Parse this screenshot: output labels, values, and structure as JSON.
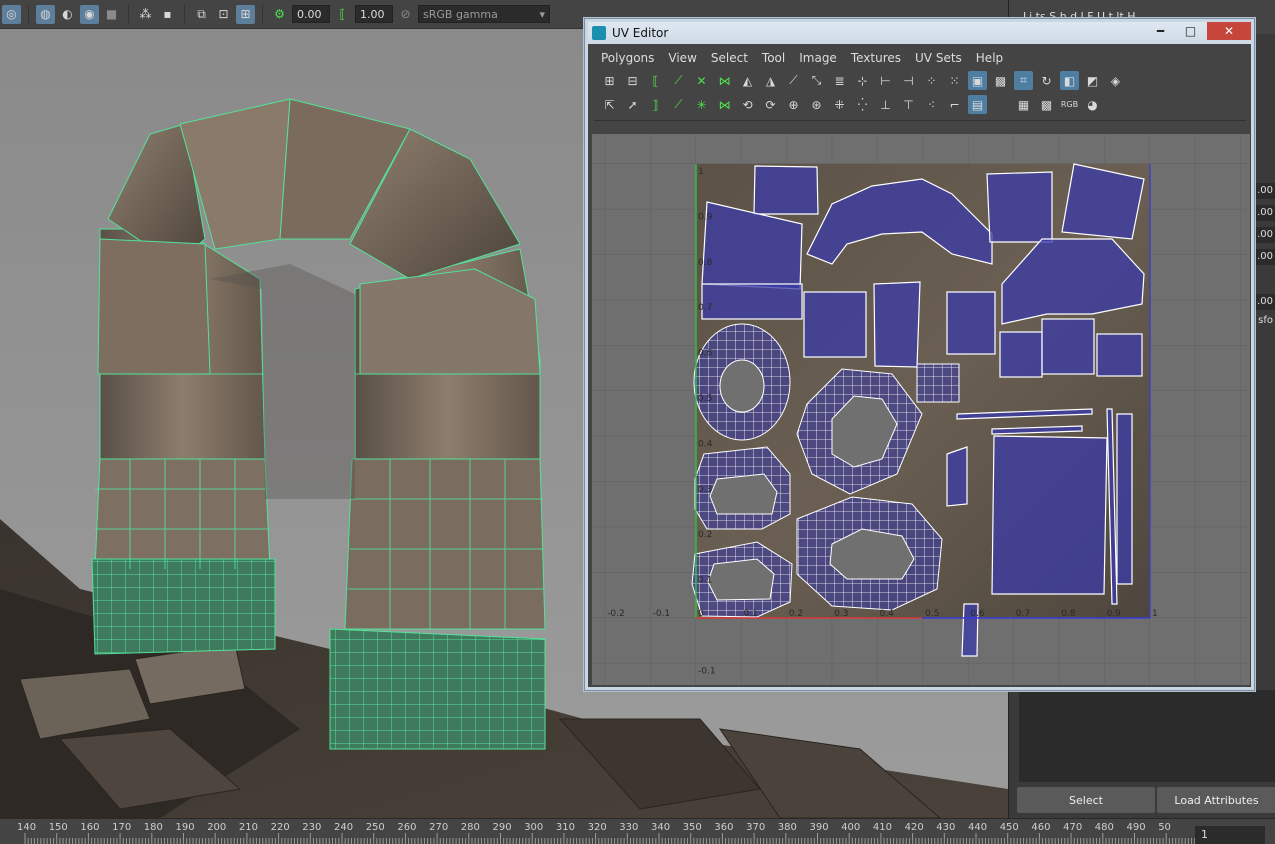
{
  "viewport_toolbar": {
    "exposure_value": "0.00",
    "gamma_value": "1.00",
    "color_space": "sRGB gamma"
  },
  "timeline": {
    "ticks": [
      "140",
      "150",
      "160",
      "170",
      "180",
      "190",
      "200",
      "210",
      "220",
      "230",
      "240",
      "250",
      "260",
      "270",
      "280",
      "290",
      "300",
      "310",
      "320",
      "330",
      "340",
      "350",
      "360",
      "370",
      "380",
      "390",
      "400",
      "410",
      "420",
      "430",
      "440",
      "450",
      "460",
      "470",
      "480",
      "490",
      "50"
    ],
    "current_frame": "1"
  },
  "attribute_panel": {
    "menu_text": "Li  ts  S  h  d  l  F  U  t  lt  H",
    "field_values": [
      ".00",
      ".00",
      ".00",
      ".00",
      ".00"
    ],
    "partial_label": "sfo",
    "select_button": "Select",
    "load_attributes_button": "Load Attributes"
  },
  "uv_editor": {
    "title": "UV Editor",
    "menus": [
      "Polygons",
      "View",
      "Select",
      "Tool",
      "Image",
      "Textures",
      "UV Sets",
      "Help"
    ],
    "grid_labels_x": [
      "-0.2",
      "-0.1",
      "0",
      "0.1",
      "0.2",
      "0.3",
      "0.4",
      "0.5",
      "0.6",
      "0.7",
      "0.8",
      "0.9",
      "1"
    ],
    "grid_labels_y": [
      "1",
      "0.9",
      "0.8",
      "0.7",
      "0.6",
      "0.5",
      "0.4",
      "0.3",
      "0.2",
      "0.1",
      "-0.1"
    ],
    "rgb_label": "RGB"
  },
  "colors": {
    "wire_green": "#54e29a",
    "uv_blue": "#3a3aa0",
    "panel_bg": "#444444",
    "select_blue": "#5d7f9b"
  }
}
